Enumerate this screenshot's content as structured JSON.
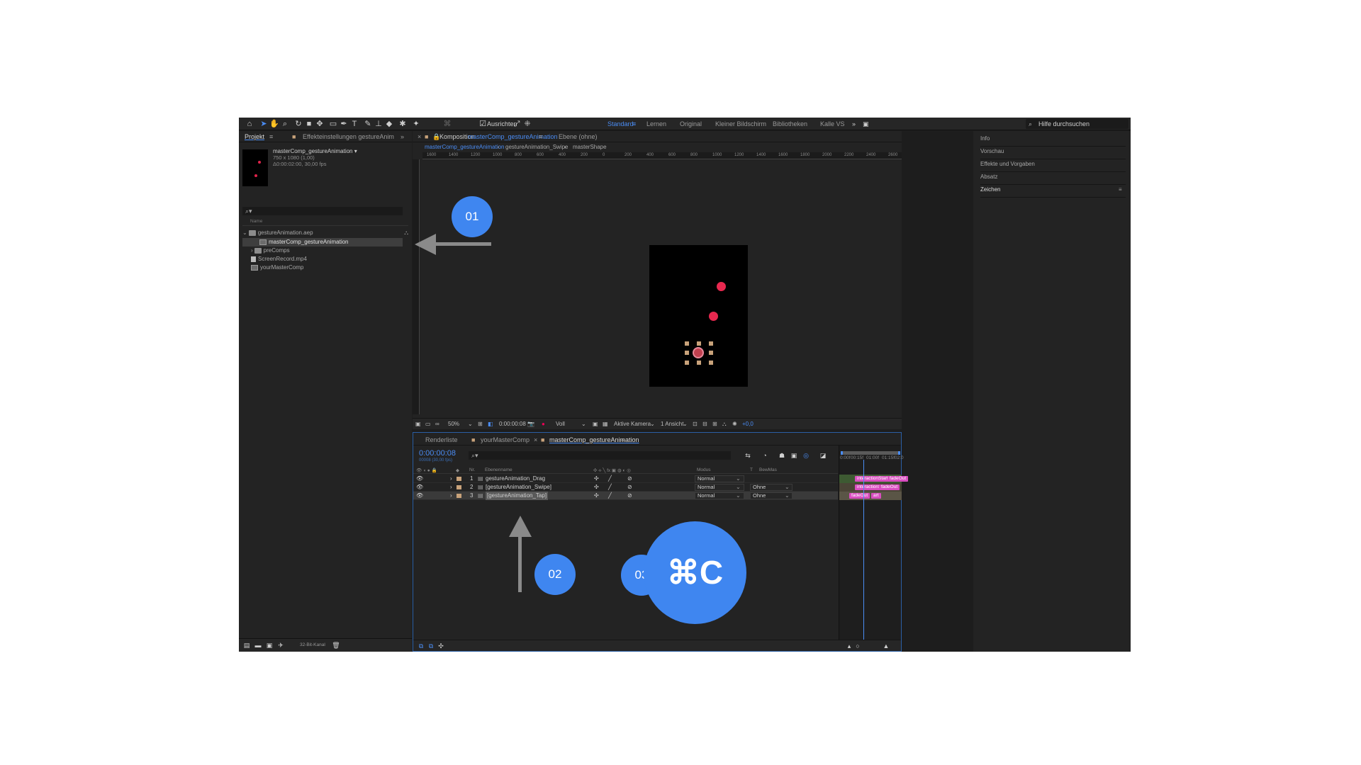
{
  "toolbar": {
    "align_label": "Ausrichten",
    "workspaces": [
      "Standard",
      "Lernen",
      "Original",
      "Kleiner Bildschirm",
      "Bibliotheken",
      "Kalle VS"
    ],
    "help_placeholder": "Hilfe durchsuchen"
  },
  "project_panel": {
    "tab_project": "Projekt",
    "tab_effects": "Effekteinstellungen gestureAnim",
    "comp_name": "masterComp_gestureAnimation ▾",
    "comp_size": "750 x 1080 (1,00)",
    "comp_duration": "Δ0:00:02:00, 30,00 fps",
    "search_glyph": "⌕▾",
    "column_name": "Name",
    "items": [
      {
        "label": "gestureAnimation.aep"
      },
      {
        "label": "masterComp_gestureAnimation"
      },
      {
        "label": "preComps"
      },
      {
        "label": "ScreenRecord.mp4"
      },
      {
        "label": "yourMasterComp"
      }
    ],
    "bit_depth": "32-Bit-Kanal"
  },
  "viewer": {
    "tab_prefix": "Komposition",
    "tab_comp": "masterComp_gestureAnimation",
    "tab_layer": "Ebene (ohne)",
    "flow": [
      "masterComp_gestureAnimation",
      "gestureAnimation_Swipe",
      "masterShape"
    ],
    "ruler_ticks": [
      "1600",
      "1400",
      "1200",
      "1000",
      "800",
      "600",
      "400",
      "200",
      "0",
      "200",
      "400",
      "600",
      "800",
      "1000",
      "1200",
      "1400",
      "1600",
      "1800",
      "2000",
      "2200",
      "2400",
      "2600"
    ],
    "zoom": "50%",
    "time": "0:00:00:08",
    "resolution": "Voll",
    "camera": "Aktive Kamera",
    "views": "1 Ansicht",
    "exposure": "+0,0"
  },
  "right_panel": {
    "items": [
      "Info",
      "Vorschau",
      "Effekte und Vorgaben",
      "Absatz",
      "Zeichen"
    ]
  },
  "timeline": {
    "tab_render": "Renderliste",
    "tab_master": "yourMasterComp",
    "tab_active": "masterComp_gestureAnimation",
    "timecode": "0:00:00:08",
    "timecode_sub": "00008 (30,00 fps)",
    "search_glyph": "⌕▾",
    "columns": {
      "nr": "Nr.",
      "name": "Ebenenname",
      "mode": "Modus",
      "t": "T",
      "trkmat": "BewMas"
    },
    "layers": [
      {
        "nr": "1",
        "name": "gestureAnimation_Drag",
        "mode": "Normal",
        "trkmat": ""
      },
      {
        "nr": "2",
        "name": "[gestureAnimation_Swipe]",
        "mode": "Normal",
        "trkmat": "Ohne"
      },
      {
        "nr": "3",
        "name": "[gestureAnimation_Tap]",
        "mode": "Normal",
        "trkmat": "Ohne"
      }
    ],
    "time_ticks": [
      "0:00f",
      "00:15f",
      "01:00f",
      "01:15f",
      "02:0"
    ],
    "markers": [
      {
        "label": "interactionStart"
      },
      {
        "label": "fadeOut"
      },
      {
        "label": "interactionStart"
      },
      {
        "label": "fadeOut"
      },
      {
        "label": "fadeOut"
      },
      {
        "label": "art"
      }
    ]
  },
  "overlays": {
    "step1": "01",
    "step2": "02",
    "step3": "03",
    "shortcut": "⌘C"
  },
  "colors": {
    "accent": "#4a8cf4",
    "badge": "#3f86f0",
    "marker": "#d94ec0",
    "dot": "#e8284f",
    "label": "#c8a27a"
  },
  "icons": [
    "home-icon",
    "selection-icon",
    "hand-icon",
    "zoom-icon",
    "rotate-icon",
    "camera-icon",
    "pan-behind-icon",
    "rectangle-icon",
    "pen-icon",
    "text-icon",
    "brush-icon",
    "stamp-icon",
    "eraser-icon",
    "roto-icon",
    "puppet-icon"
  ]
}
